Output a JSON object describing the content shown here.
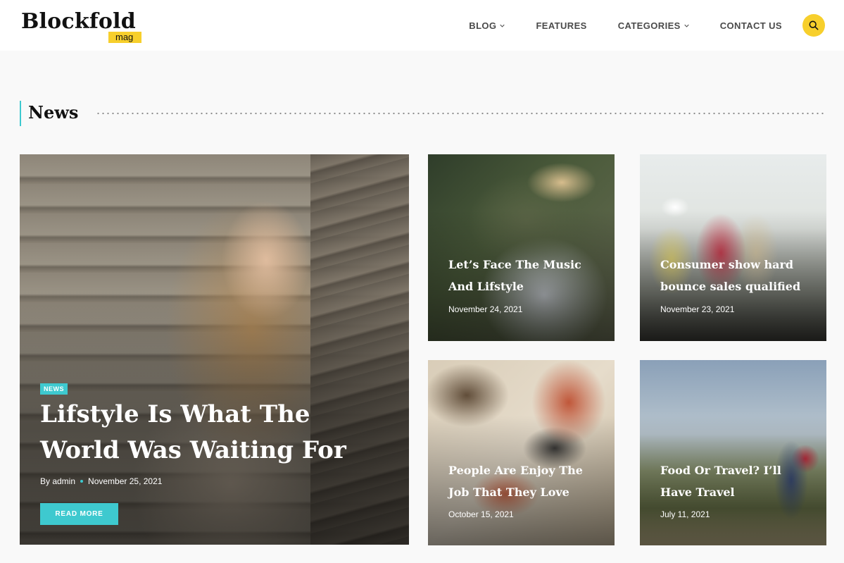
{
  "brand": {
    "name": "Blockfold",
    "sub": "mag"
  },
  "nav": {
    "items": [
      {
        "label": "BLOG",
        "dropdown": true
      },
      {
        "label": "FEATURES",
        "dropdown": false
      },
      {
        "label": "CATEGORIES",
        "dropdown": true
      },
      {
        "label": "CONTACT US",
        "dropdown": false
      }
    ],
    "search_icon": "search-icon"
  },
  "section": {
    "title": "News"
  },
  "featured": {
    "badge": "NEWS",
    "title": "Lifstyle Is What The World Was Waiting For",
    "author": "By admin",
    "date": "November 25, 2021",
    "button": "READ MORE"
  },
  "posts": [
    {
      "title": "Let’s Face The Music And Lifstyle",
      "date": "November 24, 2021"
    },
    {
      "title": "Consumer show hard bounce sales qualified",
      "date": "November 23, 2021"
    },
    {
      "title": "People Are Enjoy The Job That They Love",
      "date": "October 15, 2021"
    },
    {
      "title": "Food Or Travel? I’ll Have Travel",
      "date": "July 11, 2021"
    }
  ],
  "colors": {
    "accent": "#3ec9cf",
    "brand_yellow": "#f7cf2c"
  }
}
